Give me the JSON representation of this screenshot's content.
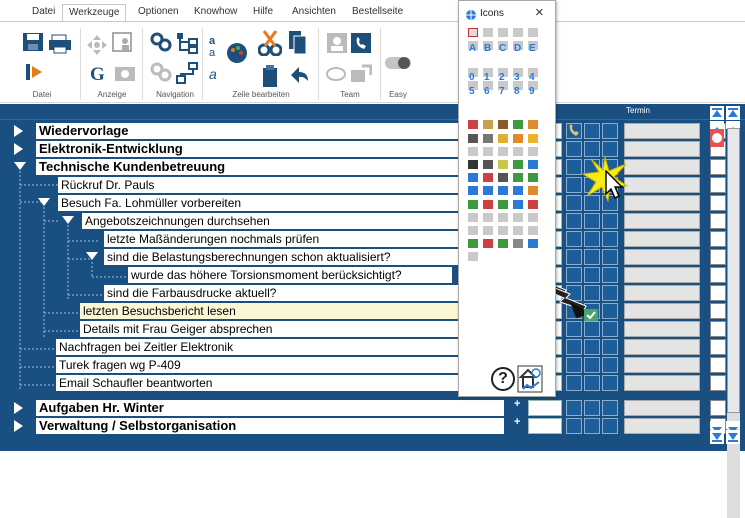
{
  "ribbon": {
    "tabs": [
      "Datei",
      "Werkzeuge",
      "Optionen",
      "Knowhow",
      "Hilfe",
      "Ansichten",
      "Bestellseite"
    ],
    "active_tab": "Werkzeuge",
    "groups": [
      "Datei",
      "Anzeige",
      "Navigation",
      "Zeile bearbeiten",
      "Team",
      "Easy"
    ]
  },
  "icons_panel": {
    "title": "Icons",
    "close": "×",
    "letters": [
      "A",
      "B",
      "C",
      "D",
      "E"
    ],
    "digits_row1": [
      "0",
      "1",
      "2",
      "3",
      "4"
    ],
    "digits_row2": [
      "5",
      "6",
      "7",
      "8",
      "9"
    ],
    "help": "?"
  },
  "grid": {
    "column_header": "Termin",
    "rows": [
      {
        "label": "Wiedervorlage",
        "bold": true
      },
      {
        "label": "Elektronik-Entwicklung",
        "bold": true
      },
      {
        "label": "Technische Kundenbetreuung",
        "bold": true
      },
      {
        "label": "Rückruf Dr. Pauls"
      },
      {
        "label": "Besuch Fa. Lohmüller vorbereiten"
      },
      {
        "label": "Angebotszeichnungen durchsehen"
      },
      {
        "label": "letzte Maßänderungen nochmals prüfen"
      },
      {
        "label": "sind die Belastungsberechnungen schon aktualisiert?"
      },
      {
        "label": "wurde das höhere Torsionsmoment berücksichtigt?"
      },
      {
        "label": "sind die Farbausdrucke aktuell?"
      },
      {
        "label": "letzten Besuchsbericht lesen",
        "highlight": true
      },
      {
        "label": "Details mit Frau Geiger absprechen"
      },
      {
        "label": "Nachfragen bei Zeitler Elektronik"
      },
      {
        "label": "Turek fragen wg P-409"
      },
      {
        "label": "Email Schaufler beantworten"
      },
      {
        "label": "Aufgaben Hr. Winter",
        "bold": true
      },
      {
        "label": "Verwaltung / Selbstorganisation",
        "bold": true
      }
    ],
    "plus": "+"
  },
  "colors": {
    "background": "#1a4f82",
    "accent": "#2b7bd6",
    "highlight": "#fbf6d3"
  }
}
